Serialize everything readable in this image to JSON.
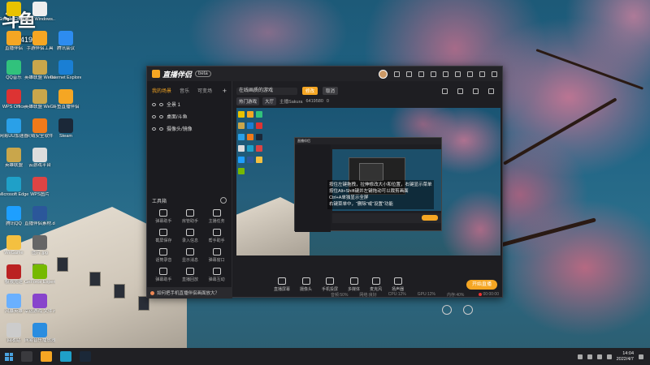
{
  "watermark": {
    "brand": "斗鱼",
    "room": "6419580"
  },
  "desktop_icons": [
    {
      "name": "Google Chrome",
      "color": "#e8c200"
    },
    {
      "name": "激活 Windows...",
      "color": "#eee"
    },
    {
      "name": "直播伴侣",
      "color": "#f5a623"
    },
    {
      "name": "手游伴侣工具",
      "color": "#f5a623"
    },
    {
      "name": "腾讯会议",
      "color": "#2d8cf0"
    },
    {
      "name": "QQ音乐",
      "color": "#31c27c"
    },
    {
      "name": "英雄联盟 WeGame版",
      "color": "#c9a64b"
    },
    {
      "name": "Internet Explorer",
      "color": "#1a7fd4"
    },
    {
      "name": "WPS Office",
      "color": "#d33"
    },
    {
      "name": "英雄联盟 WeGame版",
      "color": "#c9a64b"
    },
    {
      "name": "斗鱼直播伴侣",
      "color": "#f5a623"
    },
    {
      "name": "网易UU加速器",
      "color": "#2aa0e8"
    },
    {
      "name": "火绒安全软件",
      "color": "#f07a1a"
    },
    {
      "name": "Steam",
      "color": "#1b2838"
    },
    {
      "name": "英雄联盟",
      "color": "#c9a64b"
    },
    {
      "name": "云游戏平台",
      "color": "#ddd"
    },
    {
      "name": "Microsoft Edge",
      "color": "#1fa0c8"
    },
    {
      "name": "WPS图片",
      "color": "#d44"
    },
    {
      "name": "腾讯QQ",
      "color": "#1e9fff"
    },
    {
      "name": "直播伴侣素材.docx",
      "color": "#2b579a"
    },
    {
      "name": "WeGame",
      "color": "#f4c040"
    },
    {
      "name": "图片.jpg",
      "color": "#666"
    },
    {
      "name": "极限竞速",
      "color": "#b22"
    },
    {
      "name": "GeForce Experience",
      "color": "#76b900"
    },
    {
      "name": "风暴英雄",
      "color": "#6ab0ff"
    },
    {
      "name": "幸运游戏 文件.rar",
      "color": "#8844cc"
    },
    {
      "name": "回收站",
      "color": "#ccc"
    },
    {
      "name": "网易音乐播放器",
      "color": "#2a8de0"
    }
  ],
  "app": {
    "title": "直播伴侣",
    "version": "beta",
    "left_tabs": [
      "我的场景",
      "音乐",
      "可变场"
    ],
    "scenes": [
      "全景 1",
      "桌面/斗鱼",
      "摄像头/镜像"
    ],
    "tools_header": "工具箱",
    "tools": [
      "弹幕助手",
      "房管助手",
      "主播任务",
      "截屏保存",
      "录入信息",
      "帮手助手",
      "话筒录音",
      "显示消息",
      "弹幕窗口",
      "弹幕助手",
      "直播回放",
      "弹幕互动"
    ],
    "tip": "如何把手机直播伴侣画面放大？",
    "title_input": "在线画质的游戏",
    "btn_modify": "修改",
    "btn_cancel": "取消",
    "tags": [
      "热门游戏",
      "大厅",
      "主播Sakura",
      "6419580",
      "0"
    ],
    "overlay_text": "按住左键拖拽，拉伸修改大小和位置，右键显示菜单\n按住Alt+Shift键并左键拖动可以裁剪画面\nCtrl+A单独显示全屏\n右键菜单中，“删除”或“设置”功能",
    "controls": [
      "直播屏幕",
      "摄像头",
      "手机投屏",
      "多媒体",
      "麦克风",
      "扬声器"
    ],
    "live_button": "开始直播",
    "status": [
      "音频:50%",
      "网络:良好",
      "CPU:12%",
      "GPU:12%",
      "内存:40%"
    ],
    "timer": "00:00:00"
  },
  "taskbar": {
    "time": "14:04",
    "date": "2022/4/7"
  }
}
